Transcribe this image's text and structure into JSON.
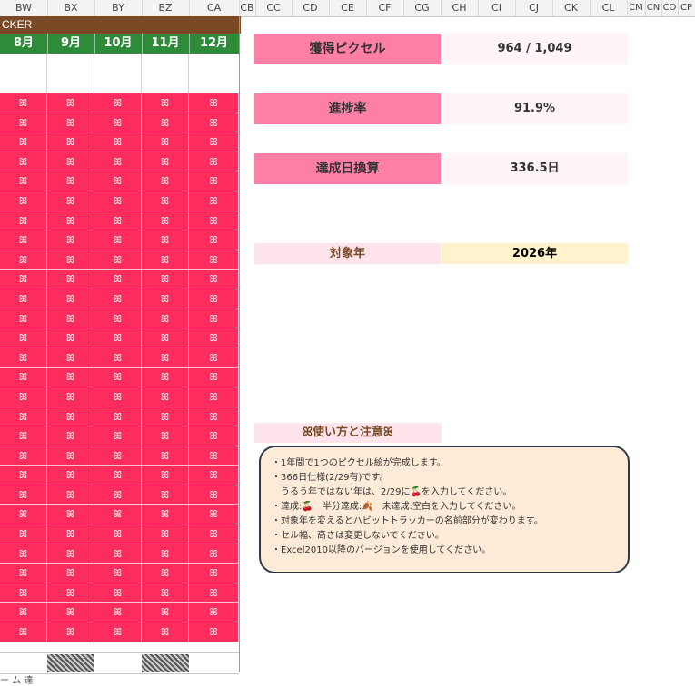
{
  "columns": [
    "BW",
    "BX",
    "BY",
    "BZ",
    "CA",
    "CB",
    "CC",
    "CD",
    "CE",
    "CF",
    "CG",
    "CH",
    "CI",
    "CJ",
    "CK",
    "CL",
    "CM",
    "CN",
    "CO",
    "CP"
  ],
  "banner_text": "CKER",
  "months": [
    "8月",
    "9月",
    "10月",
    "11月",
    "12月"
  ],
  "cell_symbol": "ꕤ",
  "grid_rows": 28,
  "stats": [
    {
      "label": "獲得ピクセル",
      "value": "964 / 1,049"
    },
    {
      "label": "進捗率",
      "value": "91.9%"
    },
    {
      "label": "達成日換算",
      "value": "336.5日"
    }
  ],
  "target_year": {
    "label": "対象年",
    "value": "2026年"
  },
  "notes": {
    "title": "ꕤ使い方と注意ꕤ",
    "lines": [
      "・1年間で1つのピクセル絵が完成します。",
      "・366日仕様(2/29有)です。",
      "　うるう年ではない年は、2/29に",
      "を入力してください。",
      "・達成:",
      "　半分達成:",
      "　未達成:空白を入力してください。",
      "・対象年を変えるとハビットトラッカーの名前部分が変わります。",
      "・セル幅、高さは変更しないでください。",
      "・Excel2010以降のバージョンを使用してください。"
    ],
    "cherry_icon": "🍒",
    "choco_icon": "🍂"
  },
  "footer_stub": "ー ム 達",
  "colors": {
    "cell": "#ff2d5e",
    "month_bar": "#2e8b3a",
    "banner": "#7a4a26",
    "stat_label": "#ff7fa6",
    "notes_border": "#2f3b4a"
  }
}
